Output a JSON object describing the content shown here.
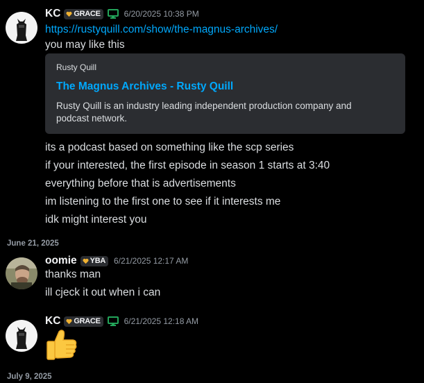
{
  "messages": [
    {
      "username": "KC",
      "tag": "GRACE",
      "timestamp": "6/20/2025 10:38 PM",
      "link": "https://rustyquill.com/show/the-magnus-archives/",
      "text": "you may like this",
      "embed": {
        "provider": "Rusty Quill",
        "title": "The Magnus Archives - Rusty Quill",
        "description": "Rusty Quill is an industry leading independent production company and podcast network."
      },
      "followups": [
        "its a podcast based on something like the scp series",
        "if your interested, the first episode in season 1 starts at 3:40",
        "everything before that is advertisements",
        "im listening to the first one to see if it interests me",
        "idk might interest you"
      ]
    },
    {
      "username": "oomie",
      "tag": "YBA",
      "timestamp": "6/21/2025 12:17 AM",
      "lines": [
        "thanks man",
        "ill cjeck it out when i can"
      ]
    },
    {
      "username": "KC",
      "tag": "GRACE",
      "timestamp": "6/21/2025 12:18 AM",
      "emoji": "thumbs-up"
    }
  ],
  "date_separators": [
    "June 21, 2025",
    "July 9, 2025"
  ],
  "colors": {
    "background": "#000000",
    "link": "#00a8fc",
    "online_green": "#23a55a",
    "tag_heart": "#f0b232"
  }
}
